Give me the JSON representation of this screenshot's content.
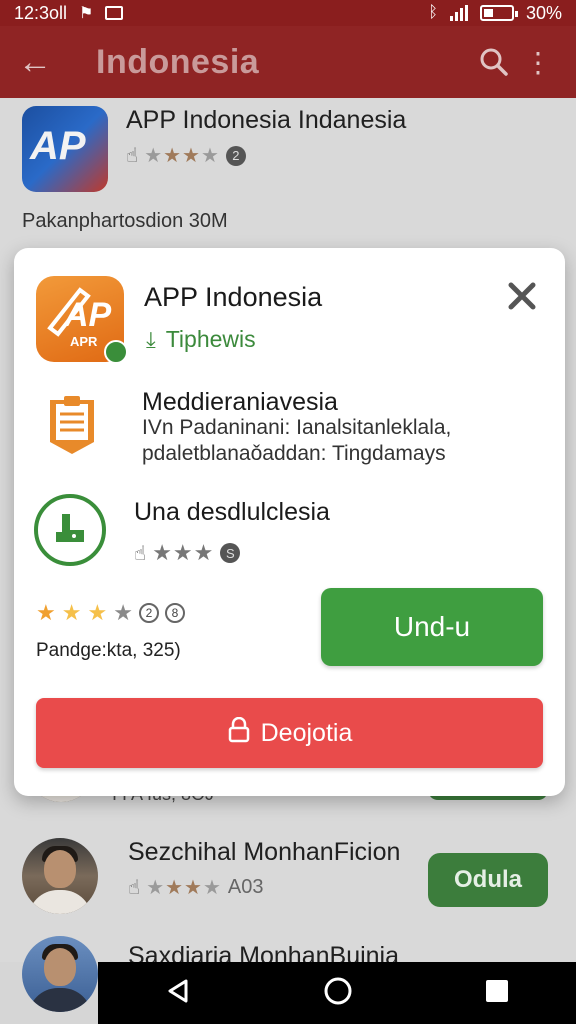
{
  "status_bar": {
    "time": "12:3oll",
    "battery": "30%"
  },
  "app_bar": {
    "title": "Indonesia"
  },
  "background_list": {
    "top_item": {
      "title": "APP Indonesia Indanesia",
      "icon_text": "AP"
    },
    "caption": "Pakanphartosdion 30M",
    "partial_item": {
      "sub": "I I A Ius, 8OJ"
    },
    "item_2": {
      "title": "Sezchihal MonhanFicion",
      "sub": "A03",
      "button": "Odula"
    },
    "item_3": {
      "title": "Saxdiaria MonhanBuinia"
    }
  },
  "dialog": {
    "app": {
      "title": "APP Indonesia",
      "subtitle": "Tiphewis",
      "icon_text": "AP",
      "icon_sub": "APR"
    },
    "row2": {
      "title": "Meddieraniavesia",
      "line1": "IVn Padaninani: Ianalsitanleklala,",
      "line2": "pdaletblanaǒaddan: Tingdamays"
    },
    "row3": {
      "title": "Una desdlulclesia",
      "badge": "S"
    },
    "rating": {
      "value": 2.5,
      "badge": "2",
      "badge2": "8"
    },
    "meta": "Pandge:kta, 325)",
    "download_label": "Und-u",
    "deposit_label": "Deojotia"
  },
  "colors": {
    "primary": "#8f2424",
    "green": "#3f9e40",
    "red": "#e94b4b",
    "orange": "#e06a14"
  },
  "icons": [
    "back-arrow-icon",
    "search-icon",
    "more-vert-icon",
    "close-icon",
    "document-icon",
    "hand-pointer-icon",
    "lock-icon",
    "nav-back-icon",
    "nav-home-icon",
    "nav-recents-icon"
  ]
}
